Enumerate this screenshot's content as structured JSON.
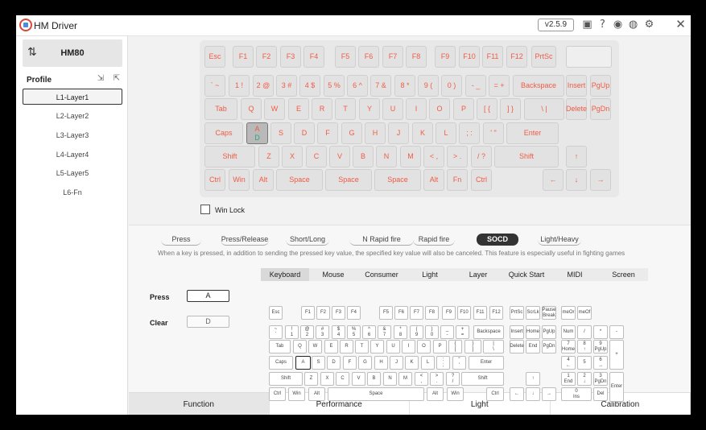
{
  "app": {
    "title": "HM Driver",
    "version": "v2.5.9",
    "icons": [
      "image-icon",
      "help-icon",
      "gamepad-icon",
      "globe-icon",
      "gear-icon",
      "close-icon"
    ]
  },
  "sidebar": {
    "device": "HM80",
    "profile_label": "Profile",
    "layers": [
      "L1-Layer1",
      "L2-Layer2",
      "L3-Layer3",
      "L4-Layer4",
      "L5-Layer5",
      "L6-Fn"
    ],
    "selected_layer": 0
  },
  "keyboard": {
    "rows": [
      [
        {
          "t": "Esc"
        },
        {
          "t": "F1"
        },
        {
          "t": "F2"
        },
        {
          "t": "F3"
        },
        {
          "t": "F4"
        },
        {
          "t": "F5"
        },
        {
          "t": "F6"
        },
        {
          "t": "F7"
        },
        {
          "t": "F8"
        },
        {
          "t": "F9"
        },
        {
          "t": "F10"
        },
        {
          "t": "F11"
        },
        {
          "t": "F12"
        },
        {
          "t": "PrtSc"
        },
        {
          "t": ""
        }
      ],
      [
        {
          "t": "` ~"
        },
        {
          "t": "1 !"
        },
        {
          "t": "2 @"
        },
        {
          "t": "3 #"
        },
        {
          "t": "4 $"
        },
        {
          "t": "5 %"
        },
        {
          "t": "6 ^"
        },
        {
          "t": "7 &"
        },
        {
          "t": "8 *"
        },
        {
          "t": "9 ("
        },
        {
          "t": "0 )"
        },
        {
          "t": "- _"
        },
        {
          "t": "= +"
        },
        {
          "t": "Backspace"
        },
        {
          "t": "Insert"
        },
        {
          "t": "PgUp"
        }
      ],
      [
        {
          "t": "Tab"
        },
        {
          "t": "Q"
        },
        {
          "t": "W"
        },
        {
          "t": "E"
        },
        {
          "t": "R"
        },
        {
          "t": "T"
        },
        {
          "t": "Y"
        },
        {
          "t": "U"
        },
        {
          "t": "I"
        },
        {
          "t": "O"
        },
        {
          "t": "P"
        },
        {
          "t": "[ {"
        },
        {
          "t": "] }"
        },
        {
          "t": "\\ |"
        },
        {
          "t": "Delete"
        },
        {
          "t": "PgDn"
        }
      ],
      [
        {
          "t": "Caps"
        },
        {
          "t": "A",
          "t2": "D",
          "sel": true
        },
        {
          "t": "S"
        },
        {
          "t": "D"
        },
        {
          "t": "F"
        },
        {
          "t": "G"
        },
        {
          "t": "H"
        },
        {
          "t": "J"
        },
        {
          "t": "K"
        },
        {
          "t": "L"
        },
        {
          "t": "; :"
        },
        {
          "t": "' \""
        },
        {
          "t": "Enter"
        }
      ],
      [
        {
          "t": "Shift"
        },
        {
          "t": "Z"
        },
        {
          "t": "X"
        },
        {
          "t": "C"
        },
        {
          "t": "V"
        },
        {
          "t": "B"
        },
        {
          "t": "N"
        },
        {
          "t": "M"
        },
        {
          "t": "< ,"
        },
        {
          "t": "> ."
        },
        {
          "t": "/ ?"
        },
        {
          "t": "Shift"
        },
        {
          "t": "↑"
        }
      ],
      [
        {
          "t": "Ctrl"
        },
        {
          "t": "Win"
        },
        {
          "t": "Alt"
        },
        {
          "t": "Space"
        },
        {
          "t": "Space"
        },
        {
          "t": "Space"
        },
        {
          "t": "Alt"
        },
        {
          "t": "Fn"
        },
        {
          "t": "Ctrl"
        },
        {
          "t": "←"
        },
        {
          "t": "↓"
        },
        {
          "t": "→"
        }
      ]
    ]
  },
  "winlock": {
    "label": "Win Lock",
    "checked": false
  },
  "modes": {
    "items": [
      "Press",
      "Press/Release",
      "Short/Long",
      "N Rapid fire",
      "Rapid fire",
      "SOCD",
      "Light/Heavy"
    ],
    "selected": 5,
    "description": "When a key is pressed, in addition to sending the pressed key value, the specified key value will also be canceled. This feature is especially useful in fighting games"
  },
  "socd": {
    "press_label": "Press",
    "press_value": "A",
    "clear_label": "Clear",
    "clear_value": "D"
  },
  "subtabs": {
    "items": [
      "Keyboard",
      "Mouse",
      "Consumer",
      "Light",
      "Layer",
      "Quick Start",
      "MIDI",
      "Screen"
    ],
    "selected": 0
  },
  "vkeyboard": {
    "main": [
      [
        "Esc",
        "",
        "F1",
        "F2",
        "F3",
        "F4",
        "",
        "F5",
        "F6",
        "F7",
        "F8",
        "",
        "F9",
        "F10",
        "F11",
        "F12"
      ],
      [
        "~\n`",
        "!\n1",
        "@\n2",
        "#\n3",
        "$\n4",
        "%\n5",
        "^\n6",
        "&\n7",
        "*\n8",
        "(\n9",
        ")\n0",
        "_\n-",
        "+\n=",
        "Backspace"
      ],
      [
        "Tab",
        "Q",
        "W",
        "E",
        "R",
        "T",
        "Y",
        "U",
        "I",
        "O",
        "P",
        "{\n[",
        "}\n]",
        "|\n\\"
      ],
      [
        "Caps",
        "A",
        "S",
        "D",
        "F",
        "G",
        "H",
        "J",
        "K",
        "L",
        ":\n;",
        "\"\n'",
        "Enter"
      ],
      [
        "Shift",
        "Z",
        "X",
        "C",
        "V",
        "B",
        "N",
        "M",
        "<\n,",
        ">\n.",
        "?\n/",
        "Shift"
      ],
      [
        "Ctrl",
        "Win",
        "Alt",
        "Space",
        "Alt",
        "Win",
        "",
        "Ctrl"
      ]
    ],
    "nav_top": [
      "PrtSc",
      "ScrLk",
      "Pause\nBreak"
    ],
    "nav": [
      [
        "Insert",
        "Home",
        "PgUp"
      ],
      [
        "Delete",
        "End",
        "PgDn"
      ]
    ],
    "arrows": [
      "↑",
      "←",
      "↓",
      "→"
    ],
    "numpad_top": [
      "meOr",
      "meOf"
    ],
    "numpad": [
      [
        "Num",
        "/",
        "*",
        "-"
      ],
      [
        "7\nHome",
        "8\n↑",
        "9\nPgUp",
        "+"
      ],
      [
        "4\n←",
        "5",
        "6\n→"
      ],
      [
        "1\nEnd",
        "2\n↓",
        "3\nPgDn",
        "Enter"
      ],
      [
        "0\nIns",
        "Del"
      ]
    ]
  },
  "bottom_tabs": {
    "items": [
      "Function",
      "Performance",
      "Light",
      "Calibration"
    ],
    "selected": 0
  }
}
